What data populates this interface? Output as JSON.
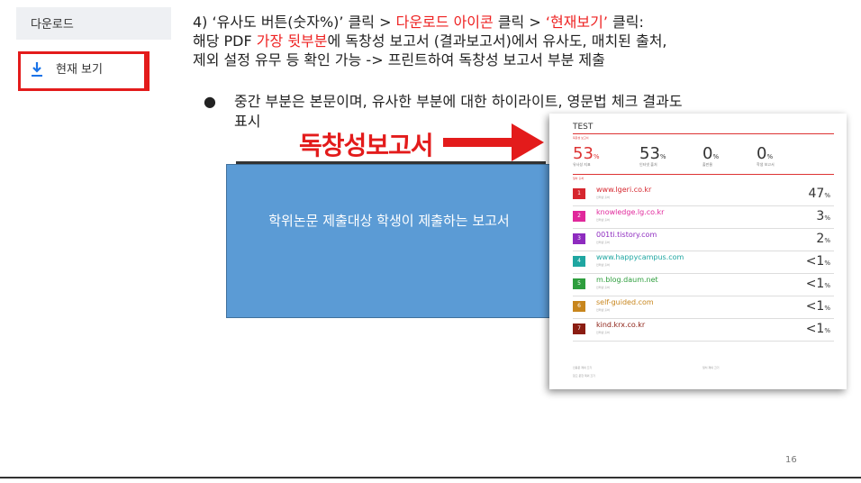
{
  "download_panel": {
    "title": "다운로드",
    "view_label": "현재 보기"
  },
  "instructions": {
    "step_prefix": "4) ‘유사도 버튼(숫자%)’ 클릭 > ",
    "step_red1": "다운로드 아이콘",
    "step_mid": " 클릭 > ",
    "step_red2": "‘현재보기’",
    "step_suffix": " 클릭:",
    "line2_prefix": "해당 PDF ",
    "line2_red": "가장 뒷부분",
    "line2_suffix": "에 독창성 보고서 (결과보고서)에서 유사도, 매치된 출처,",
    "line3": "제외 설정 유무 등 확인 가능 -> 프린트하여 독창성 보고서 부분 제출",
    "bullet_symbol": "●",
    "bullet_line1": "중간 부분은 본문이며, 유사한 부분에 대한 하이라이트, 영문법 체크 결과도",
    "bullet_line2": "표시"
  },
  "annotation": {
    "label": "독창성보고서",
    "arrow_color": "#e31b1b"
  },
  "blue_box": {
    "text": "학위논문 제출대상 학생이 제출하는 보고서",
    "color": "#5b9bd5"
  },
  "report": {
    "title": "TEST",
    "sub": "독창성 보고서",
    "stats": [
      {
        "num": "53",
        "unit": "%",
        "cap": "유사성 지표",
        "red": true
      },
      {
        "num": "53",
        "unit": "%",
        "cap": "인터넷 출처",
        "red": false
      },
      {
        "num": "0",
        "unit": "%",
        "cap": "출판물",
        "red": false
      },
      {
        "num": "0",
        "unit": "%",
        "cap": "학생 보고서",
        "red": false
      }
    ],
    "mid_cap": "일차 출처",
    "sources": [
      {
        "n": "1",
        "url": "www.lgeri.co.kr",
        "cap": "인터넷 출처",
        "pct": "47",
        "color": "#d6262e"
      },
      {
        "n": "2",
        "url": "knowledge.lg.co.kr",
        "cap": "인터넷 출처",
        "pct": "3",
        "color": "#e0289b"
      },
      {
        "n": "3",
        "url": "001ti.tistory.com",
        "cap": "인터넷 출처",
        "pct": "2",
        "color": "#8e2bbf"
      },
      {
        "n": "4",
        "url": "www.happycampus.com",
        "cap": "인터넷 출처",
        "pct": "<1",
        "color": "#1fa6a1"
      },
      {
        "n": "5",
        "url": "m.blog.daum.net",
        "cap": "인터넷 출처",
        "pct": "<1",
        "color": "#2e9e3d"
      },
      {
        "n": "6",
        "url": "self-guided.com",
        "cap": "인터넷 출처",
        "pct": "<1",
        "color": "#c8861d"
      },
      {
        "n": "7",
        "url": "kind.krx.co.kr",
        "cap": "인터넷 출처",
        "pct": "<1",
        "color": "#8b1d12"
      }
    ],
    "pct_unit": "%",
    "foot1": "인용문 제외 끄기",
    "foot2": "참고 문헌 제외 끄기",
    "foot3": "일치 제외 끄기"
  },
  "page_number": "16"
}
